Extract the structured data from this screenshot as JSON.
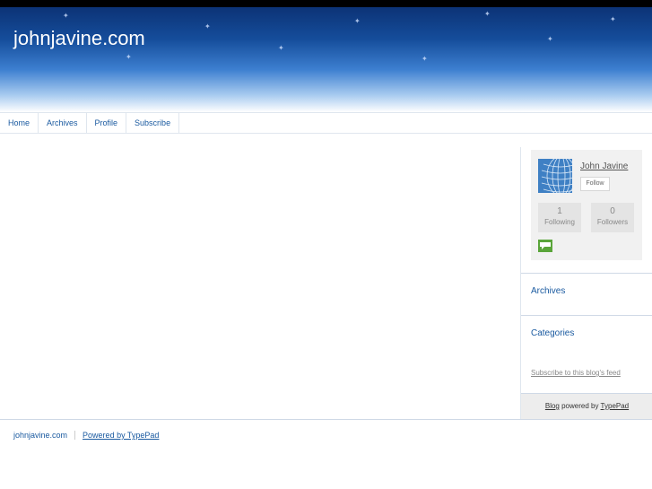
{
  "header": {
    "site_title": "johnjavine.com"
  },
  "nav": {
    "items": [
      {
        "label": "Home"
      },
      {
        "label": "Archives"
      },
      {
        "label": "Profile"
      },
      {
        "label": "Subscribe"
      }
    ]
  },
  "sidebar": {
    "profile": {
      "name": "John Javine",
      "follow_label": "Follow",
      "following": {
        "count": "1",
        "label": "Following"
      },
      "followers": {
        "count": "0",
        "label": "Followers"
      }
    },
    "archives_title": "Archives",
    "categories_title": "Categories",
    "subscribe_link": "Subscribe to this blog's feed",
    "powered": {
      "blog": "Blog",
      "middle": " powered by ",
      "typepad": "TypePad"
    }
  },
  "footer": {
    "site": "johnjavine.com",
    "powered": "Powered by TypePad"
  },
  "colors": {
    "link": "#1a5aa0",
    "banner_top": "#0a2d6e",
    "banner_mid": "#3d7fd0"
  }
}
